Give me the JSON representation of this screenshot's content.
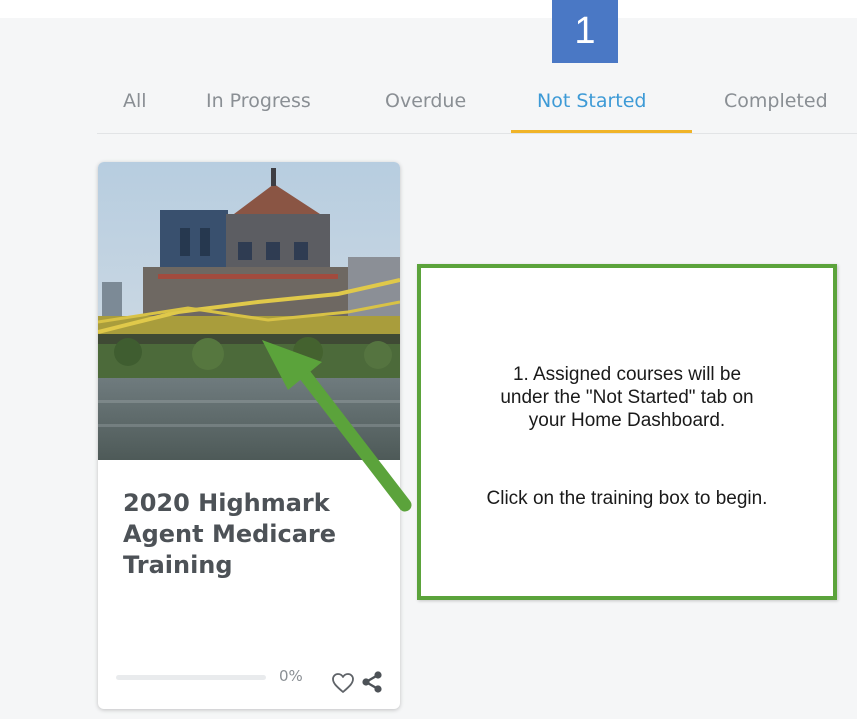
{
  "annotation": {
    "step_number": "1",
    "callout_line1": "1. Assigned courses will be",
    "callout_line2": "under the \"Not Started\" tab on",
    "callout_line3": "your Home Dashboard.",
    "callout_line4": "Click on the training box to begin.",
    "border_color": "#5ba33b",
    "badge_color": "#4a78c5"
  },
  "tabs": {
    "items": [
      {
        "label": "All"
      },
      {
        "label": "In Progress"
      },
      {
        "label": "Overdue"
      },
      {
        "label": "Not Started"
      },
      {
        "label": "Completed"
      }
    ],
    "active": "Not Started",
    "active_color": "#3d9ad6",
    "underline_color": "#f0b429"
  },
  "course": {
    "title_line1": "2020 Highmark",
    "title_line2": "Agent Medicare",
    "title_line3": "Training",
    "progress_text": "0%",
    "progress_value": 0,
    "image_icon": "city-skyline-bridge-image",
    "favorite_icon": "heart-outline-icon",
    "share_icon": "share-icon"
  }
}
